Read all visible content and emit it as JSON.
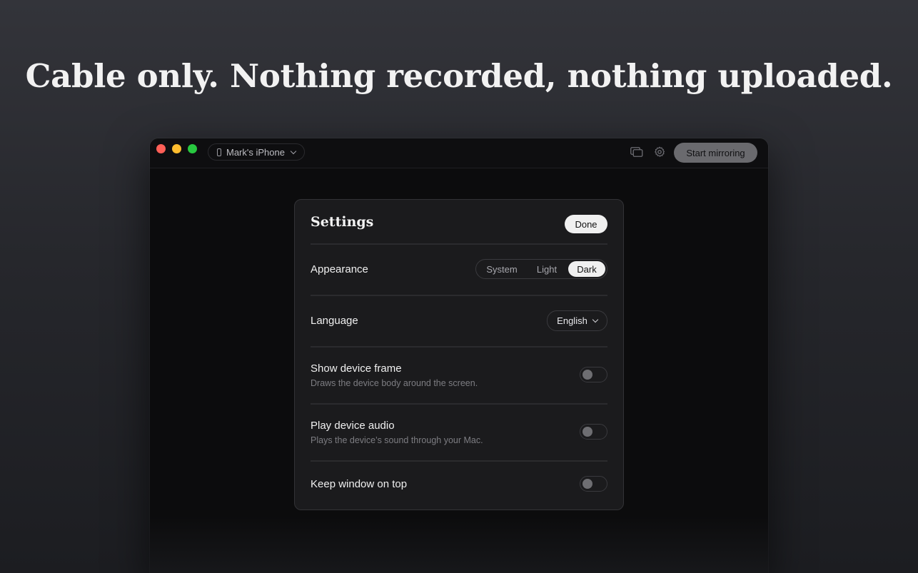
{
  "headline": "Cable only. Nothing recorded, nothing uploaded.",
  "window": {
    "device_selector": {
      "label": "Mark's iPhone",
      "icon": "phone-icon"
    },
    "toolbar": {
      "windows_icon": "windows-icon",
      "settings_icon": "gear-icon",
      "start_label": "Start mirroring"
    }
  },
  "settings": {
    "title": "Settings",
    "done_label": "Done",
    "appearance": {
      "label": "Appearance",
      "options": [
        "System",
        "Light",
        "Dark"
      ],
      "selected": "Dark"
    },
    "language": {
      "label": "Language",
      "value": "English"
    },
    "device_frame": {
      "label": "Show device frame",
      "description": "Draws the device body around the screen.",
      "enabled": false
    },
    "device_audio": {
      "label": "Play device audio",
      "description": "Plays the device’s sound through your Mac.",
      "enabled": false
    },
    "keep_on_top": {
      "label": "Keep window on top",
      "enabled": false
    }
  },
  "colors": {
    "close": "#ff5f57",
    "minimize": "#febc2e",
    "maximize": "#28c840",
    "accent_pill": "#f0f0f0"
  }
}
